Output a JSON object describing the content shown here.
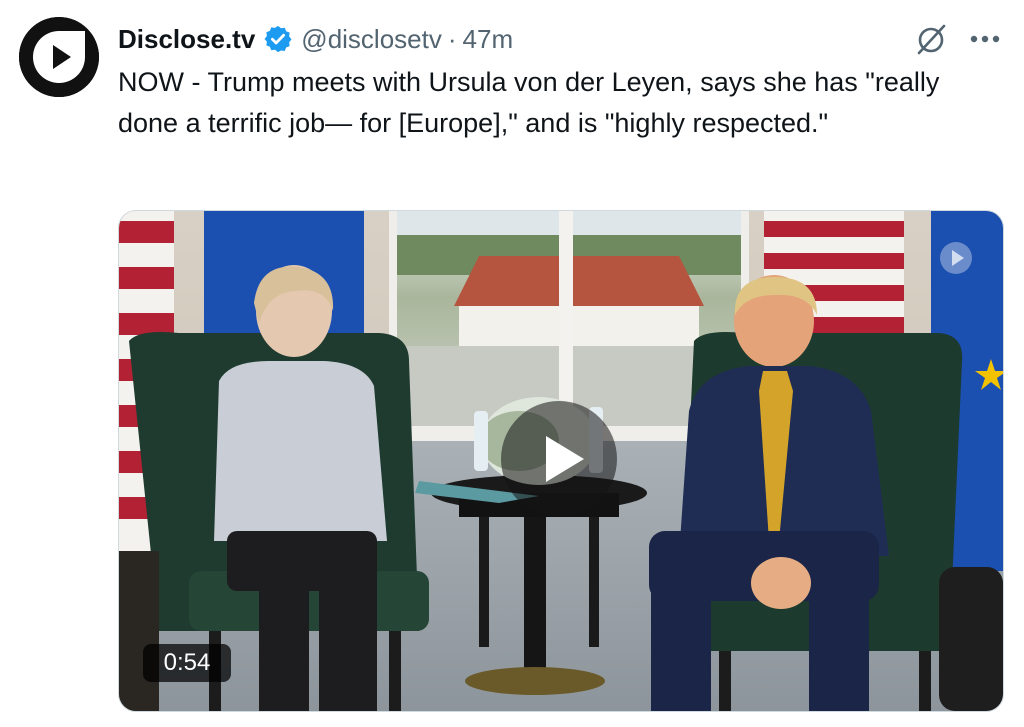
{
  "author": {
    "display_name": "Disclose.tv",
    "handle": "@disclosetv",
    "separator": "·",
    "timestamp": "47m",
    "verified": true
  },
  "tweet": {
    "text": "NOW - Trump meets with Ursula von der Leyen, says she has \"really done a terrific job— for [Europe],\" and is \"highly respected.\""
  },
  "video": {
    "duration": "0:54"
  },
  "icons": {
    "avatar": "disclose-tv-logo",
    "verified": "verified-badge-icon",
    "grok": "grok-icon",
    "more": "more-options-icon",
    "play": "play-icon"
  },
  "colors": {
    "accent": "#1d9bf0",
    "text": "#0f1419",
    "secondary_text": "#536471"
  }
}
